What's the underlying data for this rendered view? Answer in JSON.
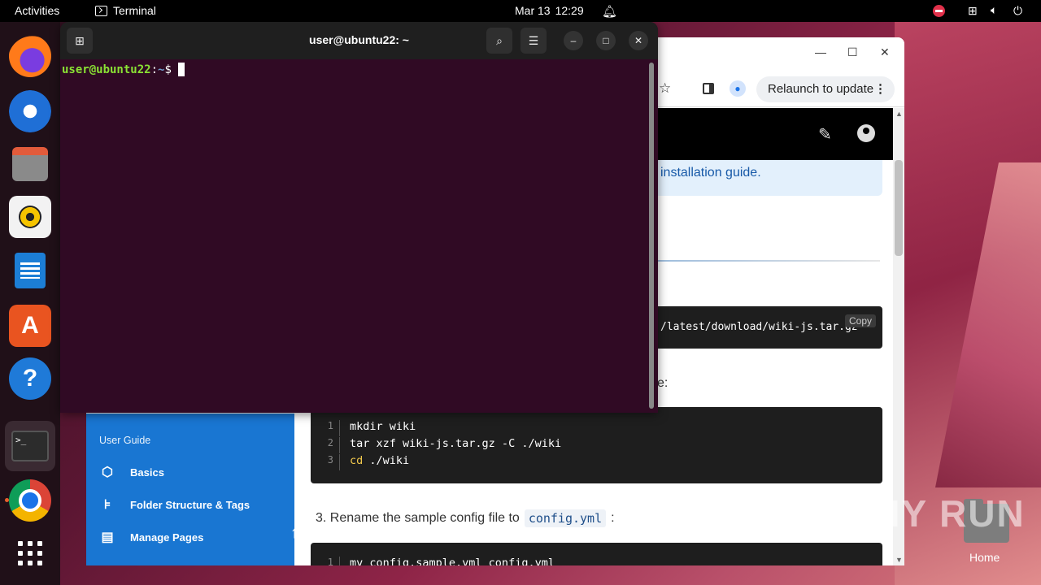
{
  "topbar": {
    "activities": "Activities",
    "app_name": "Terminal",
    "date": "Mar 13",
    "time": "12:29"
  },
  "dock": {
    "items": [
      "firefox",
      "thunderbird",
      "files",
      "rhythmbox",
      "libreoffice-writer",
      "app-center",
      "help",
      "terminal",
      "chrome",
      "show-apps"
    ]
  },
  "terminal": {
    "title": "user@ubuntu22: ~",
    "prompt_user": "user@ubuntu22",
    "prompt_sep": ":",
    "prompt_path": "~",
    "prompt_symbol": "$"
  },
  "browser": {
    "relaunch_label": "Relaunch to update",
    "info_text": "installation guide.",
    "code1_text": "/latest/download/wiki-js.tar.gz",
    "copy_label": "Copy",
    "partial_text": "e:",
    "code2": [
      {
        "num": "1",
        "cmd": "",
        "rest": "mkdir wiki"
      },
      {
        "num": "2",
        "cmd": "",
        "rest": "tar xzf wiki-js.tar.gz -C ./wiki"
      },
      {
        "num": "3",
        "cmd": "cd",
        "rest": " ./wiki"
      }
    ],
    "step3_text": "3. Rename the sample config file to",
    "step3_code": "config.yml",
    "step3_colon": ":",
    "code3": {
      "num": "1",
      "text": "mv config.sample.yml config.yml"
    },
    "nav": {
      "header": "User Guide",
      "items": [
        "Basics",
        "Folder Structure & Tags",
        "Manage Pages"
      ]
    }
  },
  "desktop": {
    "home_label": "Home",
    "watermark": "ANY RUN"
  },
  "colors": {
    "terminal_bg": "#300a24",
    "prompt_user": "#8ae234",
    "prompt_path": "#729fcf",
    "nav_bg": "#1976d2",
    "accent": "#e95420"
  }
}
